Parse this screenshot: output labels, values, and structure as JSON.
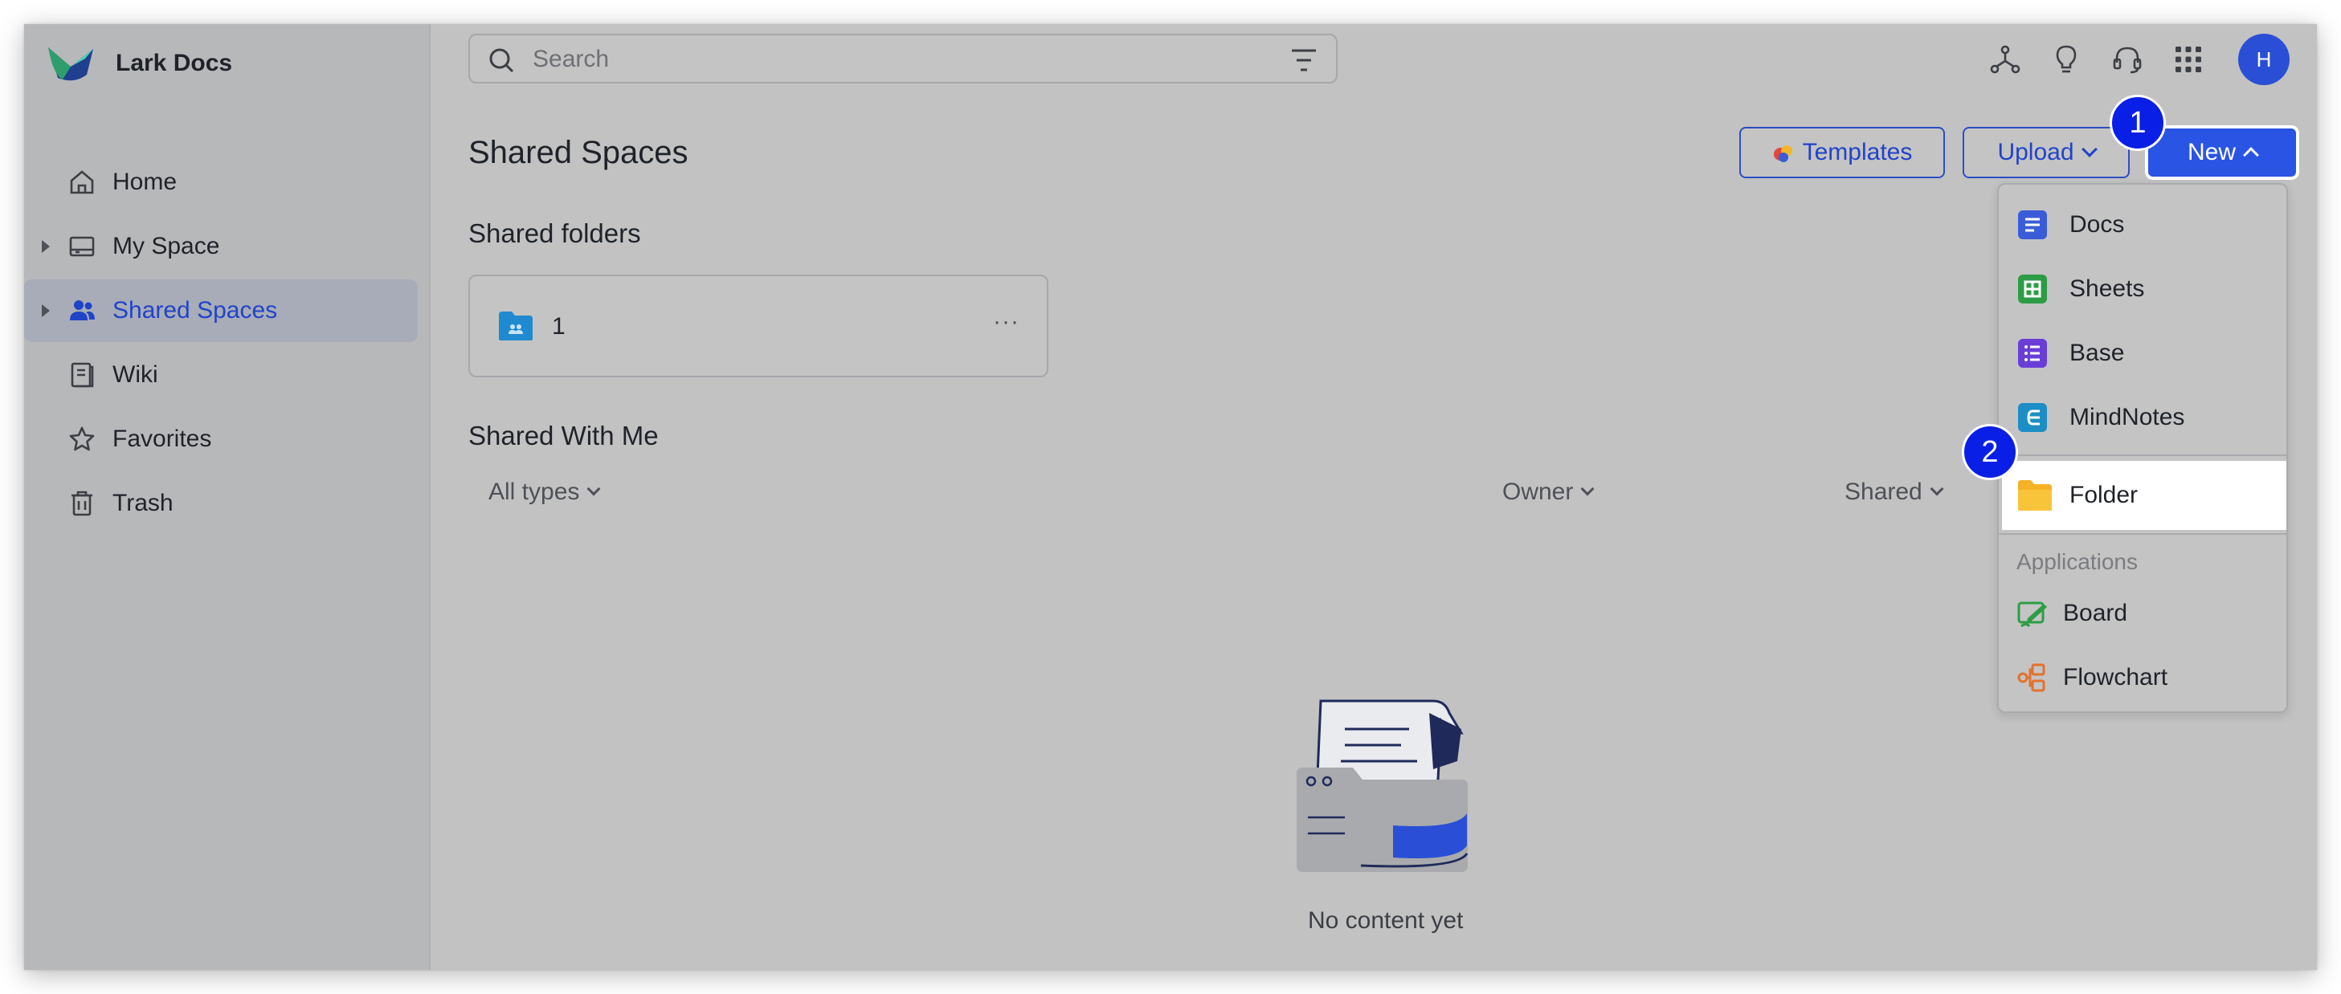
{
  "app": {
    "brand": "Lark Docs"
  },
  "sidebar": {
    "items": [
      {
        "label": "Home",
        "icon": "home-icon",
        "expandable": false,
        "active": false
      },
      {
        "label": "My Space",
        "icon": "drive-icon",
        "expandable": true,
        "active": false
      },
      {
        "label": "Shared Spaces",
        "icon": "users-icon",
        "expandable": true,
        "active": true
      },
      {
        "label": "Wiki",
        "icon": "wiki-icon",
        "expandable": false,
        "active": false
      },
      {
        "label": "Favorites",
        "icon": "star-icon",
        "expandable": false,
        "active": false
      },
      {
        "label": "Trash",
        "icon": "trash-icon",
        "expandable": false,
        "active": false
      }
    ]
  },
  "search": {
    "placeholder": "Search",
    "value": ""
  },
  "topbar": {
    "icons": [
      "network-icon",
      "lightbulb-icon",
      "headset-icon",
      "apps-grid-icon"
    ],
    "avatar_initial": "H"
  },
  "page": {
    "title": "Shared Spaces",
    "templates_label": "Templates",
    "upload_label": "Upload",
    "new_label": "New",
    "shared_folders_title": "Shared folders",
    "folder": {
      "name": "1",
      "more": "···"
    },
    "shared_with_me_title": "Shared With Me",
    "filters": {
      "types": "All types",
      "owner": "Owner",
      "shared": "Shared"
    },
    "empty_text": "No content yet"
  },
  "new_menu": {
    "items": [
      {
        "label": "Docs",
        "icon": "docs-icon",
        "color": "#3a5cd8"
      },
      {
        "label": "Sheets",
        "icon": "sheets-icon",
        "color": "#2e9c46"
      },
      {
        "label": "Base",
        "icon": "base-icon",
        "color": "#6a3ed6"
      },
      {
        "label": "MindNotes",
        "icon": "mindnotes-icon",
        "color": "#1d8ec5"
      },
      {
        "label": "Folder",
        "icon": "folder-icon",
        "color": "#f5b225"
      }
    ],
    "applications_label": "Applications",
    "applications": [
      {
        "label": "Board",
        "icon": "board-icon",
        "color": "#2e9c46"
      },
      {
        "label": "Flowchart",
        "icon": "flowchart-icon",
        "color": "#e2722c"
      }
    ]
  },
  "annotations": {
    "step1": "1",
    "step2": "2"
  },
  "colors": {
    "accent": "#2a54e3",
    "badge": "#0a1fe6",
    "active_text": "#2143c8"
  }
}
